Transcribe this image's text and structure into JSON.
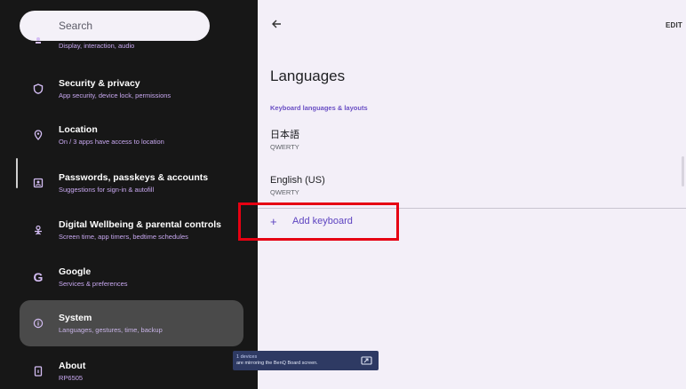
{
  "search": {
    "placeholder": "Search"
  },
  "sidebar": {
    "partial_sub": "Display, interaction, audio",
    "items": [
      {
        "title": "Security & privacy",
        "sub": "App security, device lock, permissions",
        "icon": "shield-icon"
      },
      {
        "title": "Location",
        "sub": "On / 3 apps have access to location",
        "icon": "location-pin-icon"
      },
      {
        "title": "Passwords, passkeys & accounts",
        "sub": "Suggestions for sign-in & autofill",
        "icon": "account-box-icon"
      },
      {
        "title": "Digital Wellbeing & parental controls",
        "sub": "Screen time, app timers, bedtime schedules",
        "icon": "wellbeing-icon"
      },
      {
        "title": "Google",
        "sub": "Services & preferences",
        "icon": "google-icon"
      },
      {
        "title": "System",
        "sub": "Languages, gestures, time, backup",
        "icon": "info-icon"
      },
      {
        "title": "About",
        "sub": "RP6505",
        "icon": "device-icon"
      }
    ]
  },
  "header": {
    "edit_label": "EDIT"
  },
  "main": {
    "title": "Languages",
    "section_label": "Keyboard languages & layouts",
    "keyboards": [
      {
        "name": "日本語",
        "layout": "QWERTY"
      },
      {
        "name": "English (US)",
        "layout": "QWERTY"
      }
    ],
    "add_keyboard_label": "Add keyboard",
    "add_keyboard_plus": "+"
  },
  "toast": {
    "line1": "1 devices",
    "line2": "are mirroring the BenQ Board screen."
  },
  "colors": {
    "sidebar_bg": "#171717",
    "accent": "#5d43c0",
    "highlight": "#e60012",
    "selected_bg": "#4a4a4a"
  }
}
